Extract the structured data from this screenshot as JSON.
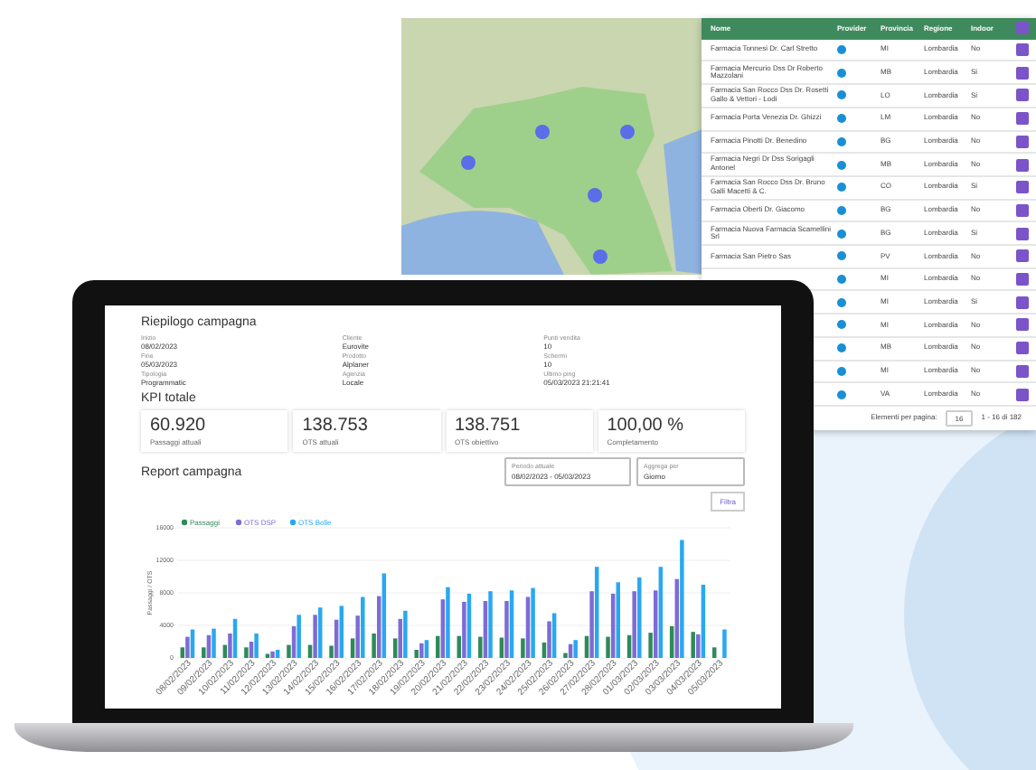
{
  "table": {
    "all_checked": true,
    "columns": [
      "Nome",
      "Provider",
      "Provincia",
      "Regione",
      "Indoor"
    ],
    "rows": [
      {
        "name": "Farmacia Tonnesi Dr. Carl Stretto",
        "provincia": "MI",
        "regione": "Lombardia",
        "indoor": "No",
        "checked": true
      },
      {
        "name": "Farmacia Mercurio Dss Dr Roberto Mazzolani",
        "provincia": "MB",
        "regione": "Lombardia",
        "indoor": "Si",
        "checked": true
      },
      {
        "name": "Farmacia San Rocco Dss Dr. Rosetti Gallo & Vettori - Lodi",
        "provincia": "LO",
        "regione": "Lombardia",
        "indoor": "Si",
        "checked": true
      },
      {
        "name": "Farmacia Porta Venezia Dr. Ghizzi",
        "provincia": "LM",
        "regione": "Lombardia",
        "indoor": "No",
        "checked": true
      },
      {
        "name": "Farmacia Pinotti Dr. Benedino",
        "provincia": "BG",
        "regione": "Lombardia",
        "indoor": "No",
        "checked": true
      },
      {
        "name": "Farmacia Negri Dr Dss Sorigagli Antonel",
        "provincia": "MB",
        "regione": "Lombardia",
        "indoor": "No",
        "checked": true
      },
      {
        "name": "Farmacia San Rocco Dss Dr. Bruno Galli Macetti & C.",
        "provincia": "CO",
        "regione": "Lombardia",
        "indoor": "Si",
        "checked": true
      },
      {
        "name": "Farmacia Oberti Dr. Giacomo",
        "provincia": "BG",
        "regione": "Lombardia",
        "indoor": "No",
        "checked": true
      },
      {
        "name": "Farmacia Nuova Farmacia Scamellini Srl",
        "provincia": "BG",
        "regione": "Lombardia",
        "indoor": "Si",
        "checked": true
      },
      {
        "name": "Farmacia San Pietro Sas",
        "provincia": "PV",
        "regione": "Lombardia",
        "indoor": "No",
        "checked": true
      },
      {
        "provincia": "MI",
        "regione": "Lombardia",
        "indoor": "No",
        "checked": true
      },
      {
        "provincia": "MI",
        "regione": "Lombardia",
        "indoor": "Si",
        "checked": true
      },
      {
        "provincia": "MI",
        "regione": "Lombardia",
        "indoor": "No",
        "checked": true
      },
      {
        "provincia": "MB",
        "regione": "Lombardia",
        "indoor": "No",
        "checked": true
      },
      {
        "provincia": "MI",
        "regione": "Lombardia",
        "indoor": "No",
        "checked": true
      },
      {
        "provincia": "VA",
        "regione": "Lombardia",
        "indoor": "No",
        "checked": true
      }
    ],
    "footer": {
      "per_page_label": "Elementi per pagina:",
      "per_page": "16",
      "range": "1 - 16 di 182"
    }
  },
  "summary": {
    "title": "Riepilogo campagna",
    "fields": [
      {
        "label": "Inizio",
        "value": "08/02/2023"
      },
      {
        "label": "Cliente",
        "value": "Eurovite"
      },
      {
        "label": "Punti vendita",
        "value": "10"
      },
      {
        "label": "Fine",
        "value": "05/03/2023"
      },
      {
        "label": "Prodotto",
        "value": "Alplaner"
      },
      {
        "label": "Schermi",
        "value": "10"
      },
      {
        "label": "Tipologia",
        "value": "Programmatic"
      },
      {
        "label": "Agenzia",
        "value": "Locale"
      },
      {
        "label": "Ultimo ping",
        "value": "05/03/2023 21:21:41"
      }
    ]
  },
  "kpi": {
    "title": "KPI totale",
    "cards": [
      {
        "value": "60.920",
        "label": "Passaggi attuali"
      },
      {
        "value": "138.753",
        "label": "OTS attuali"
      },
      {
        "value": "138.751",
        "label": "OTS obiettivo"
      },
      {
        "value": "100,00 %",
        "label": "Completamento"
      }
    ]
  },
  "report": {
    "title": "Report campagna",
    "period_label": "Periodo attuale",
    "period": "08/02/2023 - 05/03/2023",
    "group_label": "Aggrega per",
    "group": "Giorno",
    "filter_button": "Filtra",
    "chart_data": {
      "type": "bar",
      "ylabel": "Passaggi / OTS",
      "categories": [
        "08/02/2023",
        "09/02/2023",
        "10/02/2023",
        "11/02/2023",
        "12/02/2023",
        "13/02/2023",
        "14/02/2023",
        "15/02/2023",
        "16/02/2023",
        "17/02/2023",
        "18/02/2023",
        "19/02/2023",
        "20/02/2023",
        "21/02/2023",
        "22/02/2023",
        "23/02/2023",
        "24/02/2023",
        "25/02/2023",
        "26/02/2023",
        "27/02/2023",
        "28/02/2023",
        "01/03/2023",
        "02/03/2023",
        "03/03/2023",
        "04/03/2023",
        "05/03/2023"
      ],
      "series": [
        {
          "name": "Passaggi",
          "color": "#2e8b57",
          "values": [
            1300,
            1300,
            1600,
            1300,
            500,
            1600,
            1600,
            1500,
            2400,
            3000,
            2400,
            1000,
            2700,
            2700,
            2600,
            2500,
            2400,
            1900,
            600,
            2700,
            2600,
            2800,
            3100,
            3900,
            3200,
            1300
          ]
        },
        {
          "name": "OTS DSP",
          "color": "#7e6bd6",
          "values": [
            2600,
            2800,
            3000,
            2000,
            800,
            3900,
            5300,
            4700,
            5200,
            7600,
            4800,
            1800,
            7200,
            6900,
            7000,
            7000,
            7500,
            4500,
            1700,
            8200,
            7900,
            8200,
            8300,
            9700,
            2900,
            null
          ]
        },
        {
          "name": "OTS Bolle",
          "color": "#29a8f0",
          "values": [
            3500,
            3600,
            4800,
            3000,
            1000,
            5300,
            6200,
            6400,
            7500,
            10400,
            5800,
            2200,
            8700,
            7900,
            8200,
            8300,
            8600,
            5500,
            2200,
            11200,
            9300,
            9900,
            11200,
            14500,
            9000,
            3500
          ]
        }
      ],
      "grid": true,
      "legend": "top-left",
      "ylim": [
        0,
        16000
      ],
      "yticks": [
        0,
        4000,
        8000,
        12000,
        16000
      ]
    }
  }
}
